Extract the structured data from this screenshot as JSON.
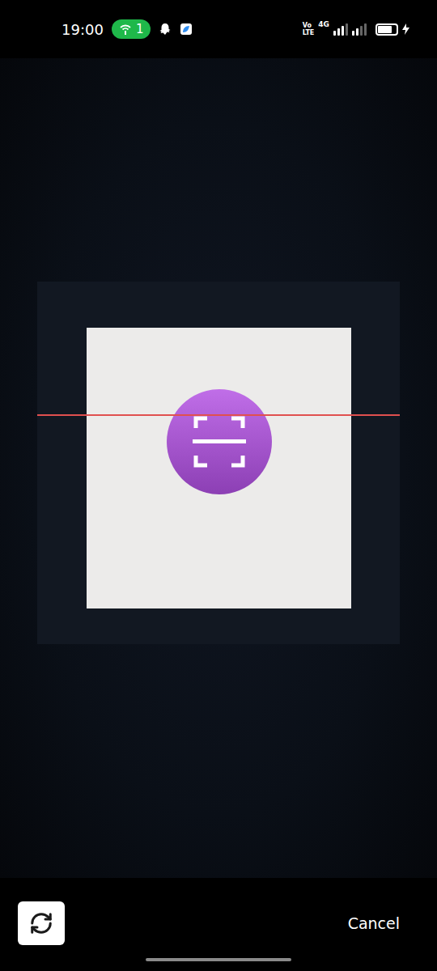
{
  "status_bar": {
    "time": "19:00",
    "hotspot_count": "1",
    "volte_top": "Vo",
    "volte_bottom": "LTE",
    "network": "4G",
    "sim1_signal": 0.75,
    "sim2_signal": 0.5,
    "battery": {
      "level": 0.75,
      "charging": true
    }
  },
  "scanner": {
    "scanning": true
  },
  "toolbar": {
    "cancel": "Cancel"
  }
}
